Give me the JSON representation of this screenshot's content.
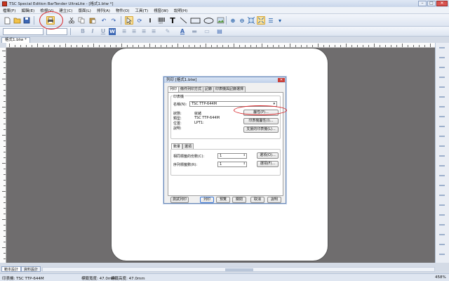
{
  "window": {
    "title": "TSC Special Edition BarTender UltraLite - [格式1.btw *]"
  },
  "window_controls": {
    "minimize": "–",
    "maximize": "□",
    "close": "✕"
  },
  "menu": [
    "檔案(F)",
    "編輯(E)",
    "檢視(V)",
    "建立(C)",
    "版面(L)",
    "排列(A)",
    "物件(O)",
    "工具(T)",
    "視窗(W)",
    "說明(H)"
  ],
  "toolbar_icons": [
    "new-icon",
    "open-icon",
    "save-icon",
    "print-icon",
    "cut-icon",
    "copy-icon",
    "paste-icon",
    "undo-icon",
    "redo-icon",
    "pointer-icon",
    "rotate-icon",
    "text-cursor-icon",
    "barcode-icon",
    "text-icon",
    "line-icon",
    "rectangle-icon",
    "ellipse-icon",
    "image-icon",
    "zoom-in-icon",
    "zoom-out-icon",
    "fit-icon",
    "zoom-100-icon",
    "database-icon"
  ],
  "document_tab": "格式1.btw *",
  "sheet_tabs": [
    "範本設計",
    "資料設計"
  ],
  "statusbar": {
    "printer": "印表機: TSC TTP-644M",
    "width": "標籤寬度: 47.0mm",
    "height": "標籤高度: 47.0mm",
    "zoom": "458%"
  },
  "dialog": {
    "title": "列印 [格式1.btw]",
    "close": "✕",
    "tabs": [
      "列印",
      "條件列印方式",
      "記錄",
      "印表機與記錄選擇"
    ],
    "printer_group": "印表機",
    "name_label": "名稱(N):",
    "name_value": "TSC TTP-644M",
    "status_label": "狀態:",
    "status_value": "就緒",
    "type_label": "類型:",
    "type_value": "TSC TTP-644M",
    "where_label": "位置:",
    "where_value": "LPT1:",
    "comment_label": "說明:",
    "comment_value": "",
    "properties_btn": "屬性(P)...",
    "printer_config_btn": "印表機屬性(I)...",
    "document_props_btn": "支援的印表機(L)...",
    "inner_tabs": [
      "數量",
      "選項"
    ],
    "copies_label": "相同標籤的份數(C):",
    "copies_value": "1",
    "copies_btn": "選項(O)...",
    "serial_label": "序列標籤數(R):",
    "serial_value": "1",
    "serial_btn": "選項(F)...",
    "bottom_left_btn": "測試列印",
    "print_btn": "列印",
    "preview_btn": "預覽",
    "close_btn": "關閉",
    "cancel_btn": "取消",
    "help_btn": "說明"
  },
  "highlight_color": "#d8262a"
}
